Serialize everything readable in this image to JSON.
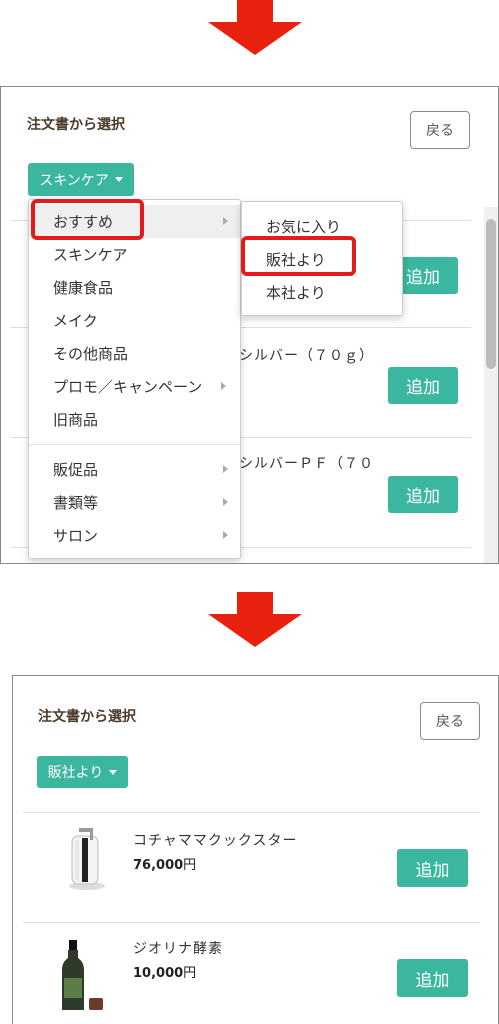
{
  "colors": {
    "accent": "#3bb7a0",
    "arrow": "#e8210f",
    "highlight": "#e21c1c"
  },
  "before": {
    "title": "注文書から選択",
    "back_label": "戻る",
    "category_label": "スキンケア",
    "add_label": "追加",
    "partial_names": [
      "シルバー（７０ｇ）",
      "シルバーＰＦ（７０"
    ],
    "menu_items": [
      "おすすめ",
      "スキンケア",
      "健康食品",
      "メイク",
      "その他商品",
      "プロモ／キャンペーン",
      "旧商品"
    ],
    "menu_items_2": [
      "販促品",
      "書類等",
      "サロン"
    ],
    "submenu_items": [
      "お気に入り",
      "販社より",
      "本社より"
    ]
  },
  "after": {
    "title": "注文書から選択",
    "back_label": "戻る",
    "category_label": "販社より",
    "add_label": "追加",
    "products": [
      {
        "name": "コチャママクックスター",
        "price": "76,000",
        "yen": "円"
      },
      {
        "name": "ジオリナ酵素",
        "price": "10,000",
        "yen": "円"
      }
    ]
  }
}
